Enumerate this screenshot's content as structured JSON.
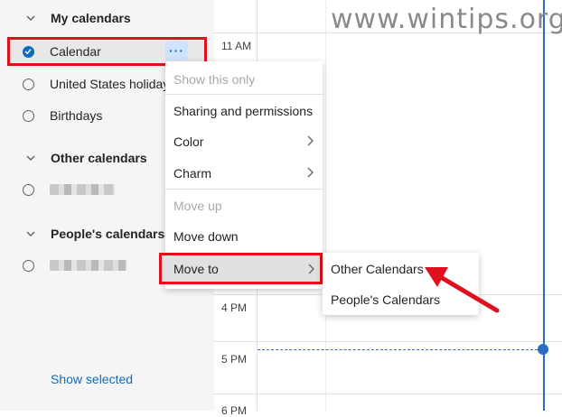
{
  "sidebar": {
    "my_calendars": {
      "heading": "My calendars",
      "items": [
        {
          "name": "Calendar",
          "checked": true
        },
        {
          "name": "United States holidays",
          "checked": false
        },
        {
          "name": "Birthdays",
          "checked": false
        }
      ]
    },
    "other_calendars": {
      "heading": "Other calendars"
    },
    "peoples_calendars": {
      "heading": "People's calendars"
    },
    "more_button": "···",
    "show_selected": "Show selected"
  },
  "grid": {
    "times": [
      "11 AM",
      "4 PM",
      "5 PM",
      "6 PM"
    ]
  },
  "context_menu": {
    "items": [
      {
        "label": "Show this only",
        "disabled": true
      },
      {
        "label": "Sharing and permissions",
        "disabled": false
      },
      {
        "label": "Color",
        "disabled": false,
        "submenu": true
      },
      {
        "label": "Charm",
        "disabled": false,
        "submenu": true
      },
      {
        "label": "Move up",
        "disabled": true
      },
      {
        "label": "Move down",
        "disabled": false
      },
      {
        "label": "Move to",
        "disabled": false,
        "submenu": true,
        "highlighted": true
      }
    ]
  },
  "submenu": {
    "items": [
      {
        "label": "Other Calendars"
      },
      {
        "label": "People's Calendars"
      }
    ]
  },
  "watermark": "www.wintips.org",
  "colors": {
    "accent": "#0f6cbd",
    "highlight_border": "#e0101e",
    "arrow": "#e0101e",
    "now_line": "#2b6cc4"
  }
}
